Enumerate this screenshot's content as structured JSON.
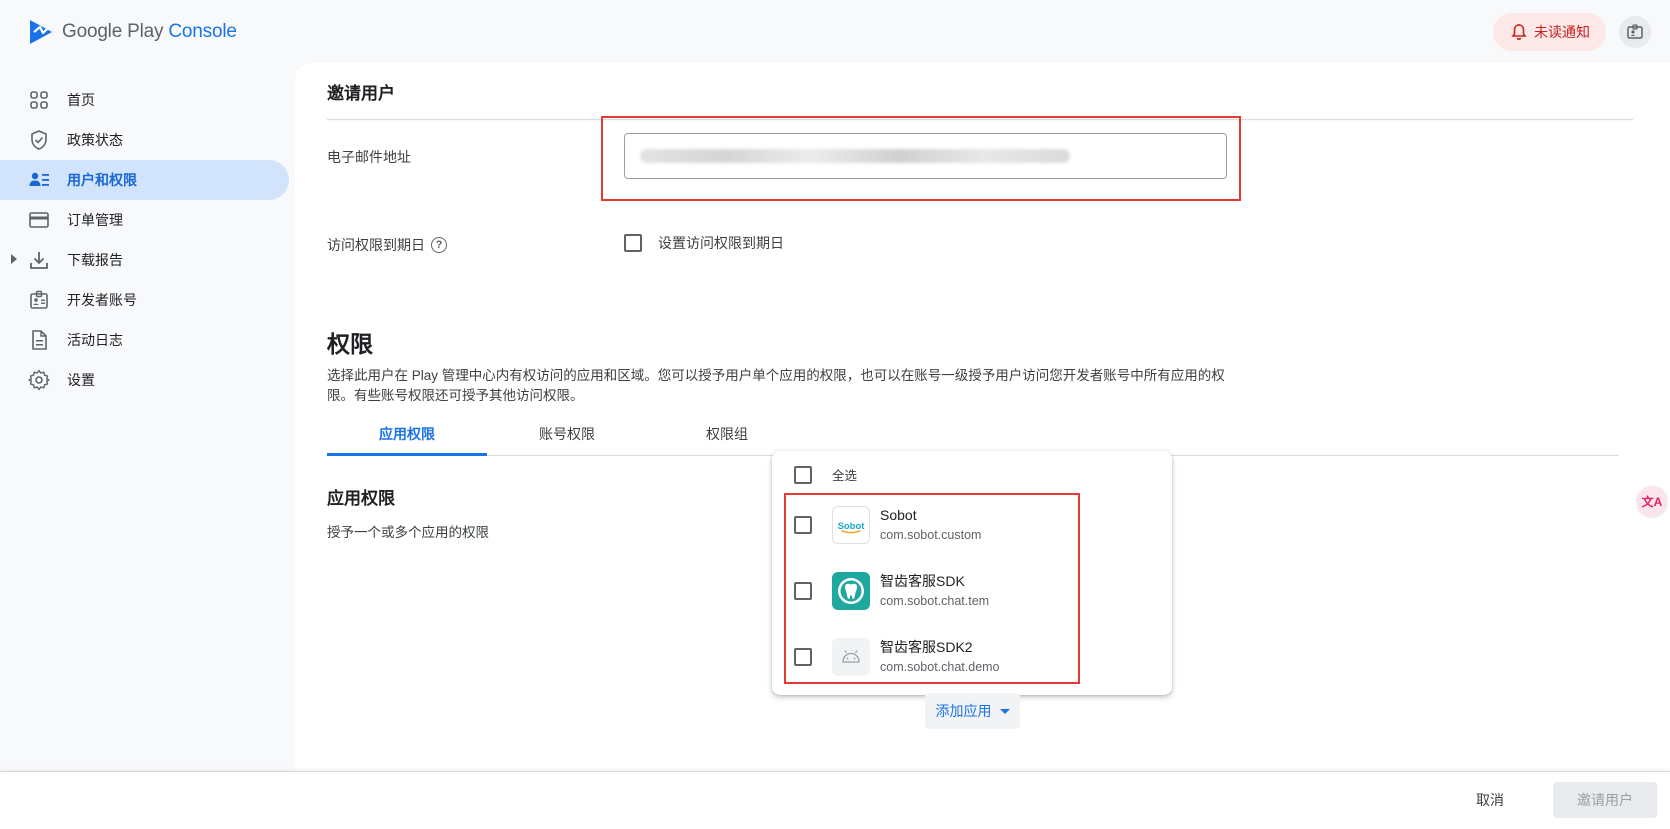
{
  "header": {
    "logo_prefix": "Google Play ",
    "logo_suffix": "Console",
    "notification_label": "未读通知"
  },
  "sidebar": {
    "items": [
      {
        "label": "首页",
        "icon": "dashboard-icon",
        "active": false
      },
      {
        "label": "政策状态",
        "icon": "shield-check-icon",
        "active": false
      },
      {
        "label": "用户和权限",
        "icon": "users-list-icon",
        "active": true
      },
      {
        "label": "订单管理",
        "icon": "credit-card-icon",
        "active": false
      },
      {
        "label": "下载报告",
        "icon": "download-icon",
        "active": false,
        "expandable": true
      },
      {
        "label": "开发者账号",
        "icon": "badge-icon",
        "active": false
      },
      {
        "label": "活动日志",
        "icon": "document-icon",
        "active": false
      },
      {
        "label": "设置",
        "icon": "gear-icon",
        "active": false
      }
    ]
  },
  "invite": {
    "title": "邀请用户",
    "email_label": "电子邮件地址",
    "email_value": "",
    "expiry_label": "访问权限到期日",
    "expiry_checkbox_label": "设置访问权限到期日"
  },
  "permissions": {
    "title": "权限",
    "description": "选择此用户在 Play 管理中心内有权访问的应用和区域。您可以授予用户单个应用的权限，也可以在账号一级授予用户访问您开发者账号中所有应用的权限。有些账号权限还可授予其他访问权限。",
    "tabs": [
      "应用权限",
      "账号权限",
      "权限组"
    ],
    "active_tab": 0,
    "app_section_title": "应用权限",
    "app_section_desc": "授予一个或多个应用的权限"
  },
  "dropdown": {
    "select_all": "全选",
    "apps": [
      {
        "name": "Sobot",
        "package": "com.sobot.custom",
        "icon": "sobot-logo",
        "checked": false
      },
      {
        "name": "智齿客服SDK",
        "package": "com.sobot.chat.tem",
        "icon": "tooth-icon",
        "checked": false
      },
      {
        "name": "智齿客服SDK2",
        "package": "com.sobot.chat.demo",
        "icon": "android-icon",
        "checked": false
      }
    ],
    "add_app_label": "添加应用"
  },
  "footer": {
    "cancel_label": "取消",
    "invite_label": "邀请用户"
  },
  "colors": {
    "accent": "#1a73e8",
    "nav_active_bg": "#d2e3fc",
    "highlight_border": "#e53935",
    "notification_bg": "#fce8e6",
    "notification_text": "#c5221f"
  }
}
